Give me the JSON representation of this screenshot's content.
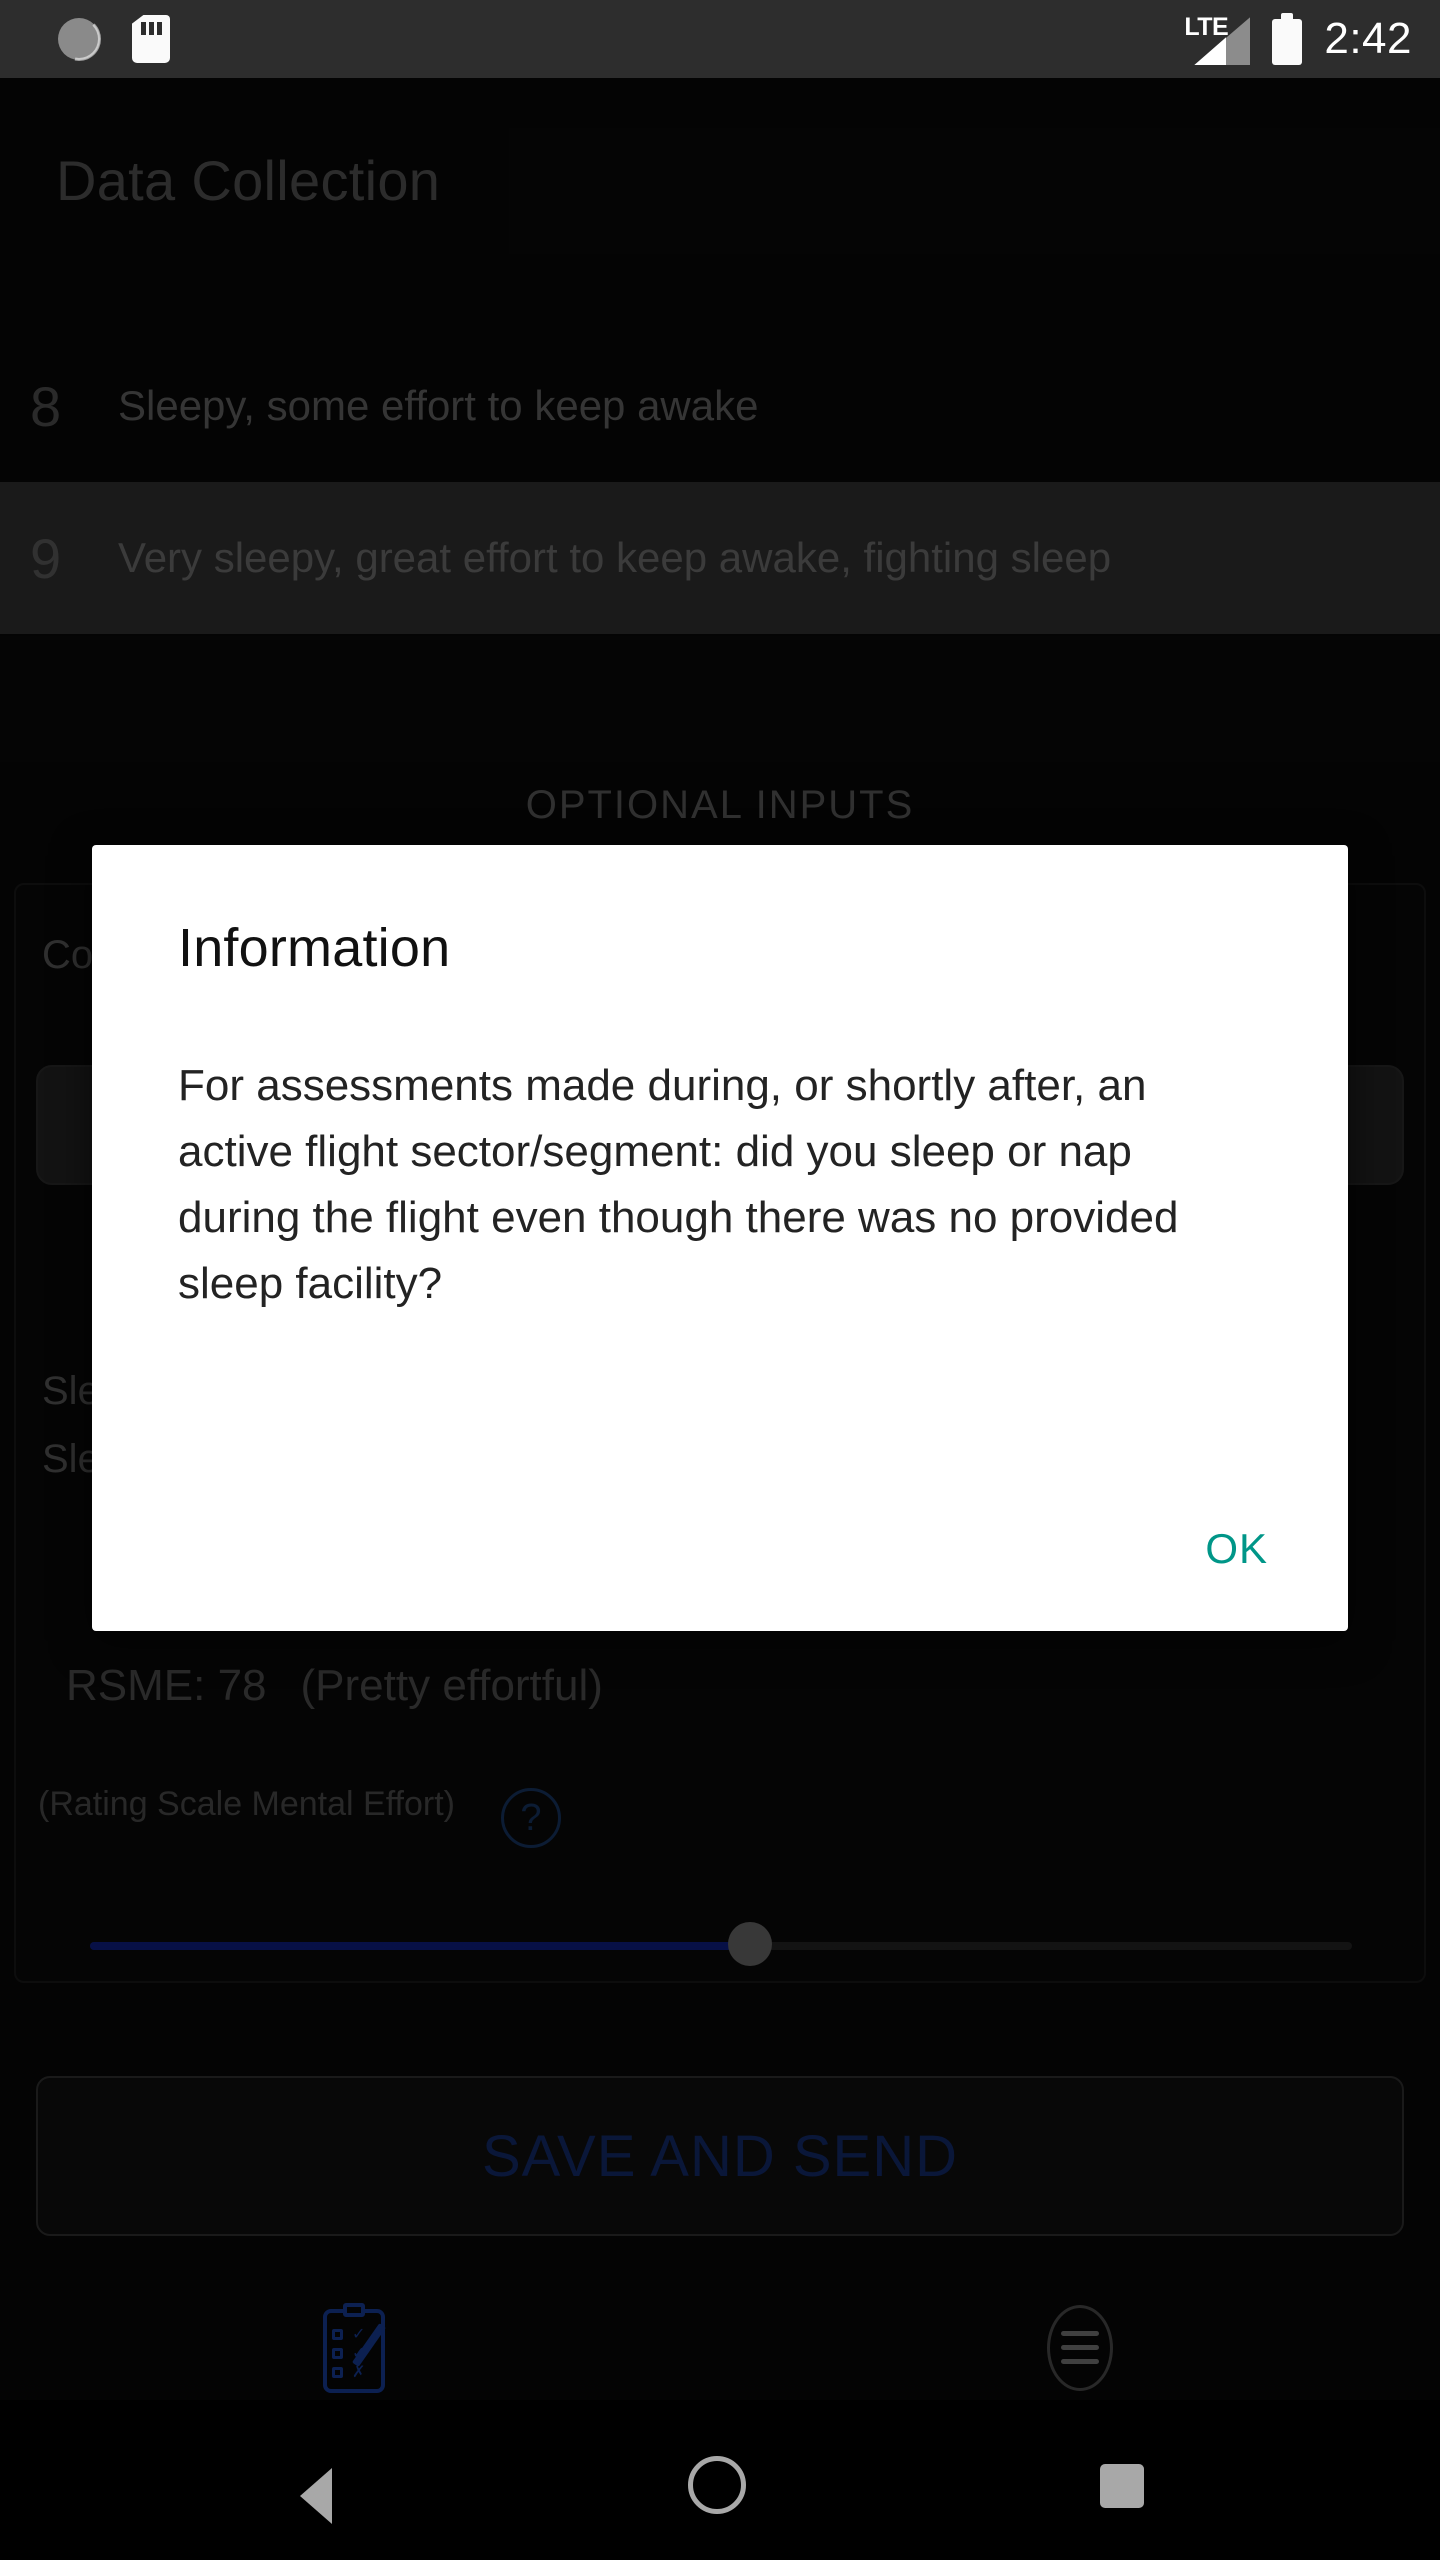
{
  "status_bar": {
    "icons_left": [
      "brightness-icon",
      "sd-card-icon"
    ],
    "network_label": "LTE",
    "signal_icon": "signal-bars-icon",
    "battery_icon": "battery-icon",
    "time": "2:42"
  },
  "app": {
    "title": "Data Collection",
    "scale_items": [
      {
        "number": "8",
        "label": "Sleepy, some effort to keep awake",
        "selected": false
      },
      {
        "number": "9",
        "label": "Very sleepy, great effort to keep awake, fighting sleep",
        "selected": true
      }
    ],
    "section_label": "OPTIONAL INPUTS",
    "comments_label": "Co",
    "comments_value": "",
    "sleep_label_1": "Sle",
    "sleep_label_2": "Sle",
    "rsme_label": "RSME: 78",
    "rsme_descriptor": "(Pretty effortful)",
    "rsme_sub": "(Rating Scale Mental Effort)",
    "help_icon_glyph": "?",
    "slider": {
      "value": "78",
      "fill_percent": 52
    },
    "save_button": "SAVE AND SEND"
  },
  "tabs": [
    {
      "label": "Data Collection",
      "icon": "clipboard-checklist-icon",
      "active": true
    },
    {
      "label": "Menu",
      "icon": "hamburger-menu-icon",
      "active": false
    }
  ],
  "dialog": {
    "title": "Information",
    "body": " For assessments made during, or shortly after, an active flight sector/segment: did you sleep or nap during the flight even though there was no provided sleep facility?",
    "ok_label": "OK"
  },
  "nav_bar": {
    "back": "back-triangle-icon",
    "home": "home-circle-icon",
    "recents": "recents-square-icon"
  },
  "colors": {
    "accent_teal": "#009688",
    "accent_blue": "#1b47b4",
    "status_bar_bg": "#2d2d2d",
    "app_bg": "#0a0a0a",
    "dialog_bg": "#ffffff"
  }
}
